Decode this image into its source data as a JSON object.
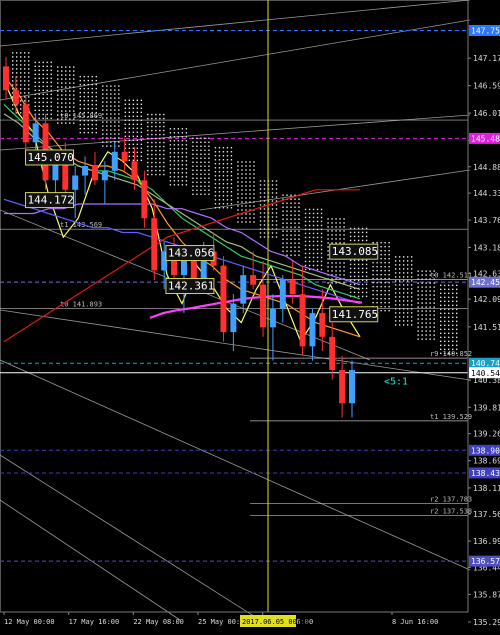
{
  "chart_data": {
    "type": "line",
    "background": "#000000",
    "ylim": [
      135.5,
      148.4
    ],
    "y_ticks": [
      "147.175",
      "146.595",
      "146.015",
      "145.440",
      "144.885",
      "144.330",
      "143.760",
      "143.185",
      "142.635",
      "142.095",
      "141.510",
      "140.385",
      "139.815",
      "139.260",
      "138.690",
      "138.115",
      "137.565",
      "136.995",
      "136.440",
      "135.870",
      "135.290"
    ],
    "x_ticks": [
      "12 May 00:00",
      "17 May 16:00",
      "22 May 08:00",
      "25 May 00:00",
      "29 May 16:00",
      "2017.06.05 00:00",
      "8 Jun 16:00"
    ],
    "highlighted_x_label": "2017.06.05 00:00",
    "price_badges": [
      {
        "text": "147.757",
        "value": 147.757,
        "color": "#2a78ff"
      },
      {
        "text": "145.483",
        "value": 145.483,
        "color": "#e020e0"
      },
      {
        "text": "142.452",
        "value": 142.452,
        "color": "#7070d0"
      },
      {
        "text": "140.744",
        "value": 140.744,
        "color": "#18a0c8"
      },
      {
        "text": "140.543",
        "value": 140.543,
        "color": "#ffffff"
      },
      {
        "text": "138.909",
        "value": 138.909,
        "color": "#4040c0"
      },
      {
        "text": "138.431",
        "value": 138.431,
        "color": "#4040c0"
      },
      {
        "text": "136.572",
        "value": 136.572,
        "color": "#5050c0"
      }
    ],
    "line_labels": [
      {
        "text": "t0 142.511",
        "value": 142.511,
        "anchor": "right"
      },
      {
        "text": "t0 141.893",
        "value": 141.893,
        "anchor": "left"
      },
      {
        "text": "t1 143.569",
        "value": 143.569,
        "anchor": "left"
      },
      {
        "text": "t0 145.869",
        "value": 145.869,
        "anchor": "left"
      },
      {
        "text": "r9 140.852",
        "value": 140.852,
        "anchor": "right"
      },
      {
        "text": "t1 139.529",
        "value": 139.529,
        "anchor": "right"
      },
      {
        "text": "r2 137.783",
        "value": 137.783,
        "anchor": "right"
      },
      {
        "text": "r2 137.538",
        "value": 137.538,
        "anchor": "right"
      }
    ],
    "box_labels": [
      {
        "text": "145.070",
        "value": 145.07,
        "x": 0.14
      },
      {
        "text": "144.172",
        "value": 144.172,
        "x": 0.14
      },
      {
        "text": "143.056",
        "value": 143.056,
        "x": 0.44
      },
      {
        "text": "142.361",
        "value": 142.361,
        "x": 0.44
      },
      {
        "text": "143.085",
        "value": 143.085,
        "x": 0.79
      },
      {
        "text": "141.765",
        "value": 141.765,
        "x": 0.79
      }
    ],
    "ratio_label": {
      "text": "<5:1",
      "color": "#20e0e0"
    },
    "candles": [
      [
        147.0,
        147.2,
        146.3,
        146.5
      ],
      [
        146.5,
        146.8,
        146.0,
        146.2
      ],
      [
        146.2,
        146.4,
        145.2,
        145.4
      ],
      [
        145.4,
        146.0,
        145.0,
        145.8
      ],
      [
        145.8,
        146.0,
        144.4,
        144.6
      ],
      [
        144.6,
        145.2,
        144.0,
        145.0
      ],
      [
        145.0,
        145.4,
        144.2,
        144.4
      ],
      [
        144.4,
        144.9,
        143.8,
        144.7
      ],
      [
        144.7,
        145.1,
        144.3,
        144.9
      ],
      [
        144.9,
        145.2,
        144.5,
        144.6
      ],
      [
        144.6,
        145.0,
        144.1,
        144.8
      ],
      [
        144.8,
        145.4,
        144.6,
        145.2
      ],
      [
        145.2,
        145.5,
        144.8,
        145.0
      ],
      [
        145.0,
        145.3,
        144.4,
        144.6
      ],
      [
        144.6,
        144.8,
        143.6,
        143.8
      ],
      [
        143.8,
        144.2,
        142.5,
        142.7
      ],
      [
        142.7,
        143.3,
        142.3,
        143.1
      ],
      [
        143.1,
        143.4,
        142.4,
        142.6
      ],
      [
        142.6,
        143.0,
        141.8,
        142.9
      ],
      [
        142.9,
        143.2,
        142.4,
        142.5
      ],
      [
        142.5,
        143.3,
        142.3,
        143.1
      ],
      [
        143.1,
        143.5,
        142.7,
        142.8
      ],
      [
        142.8,
        143.0,
        141.2,
        141.4
      ],
      [
        141.4,
        142.2,
        141.0,
        142.0
      ],
      [
        142.0,
        142.8,
        141.8,
        142.6
      ],
      [
        142.6,
        143.1,
        142.3,
        142.4
      ],
      [
        142.4,
        142.9,
        141.3,
        141.5
      ],
      [
        141.5,
        142.2,
        140.8,
        141.9
      ],
      [
        141.9,
        142.6,
        141.6,
        142.5
      ],
      [
        142.5,
        142.9,
        142.0,
        142.2
      ],
      [
        142.2,
        142.8,
        140.9,
        141.1
      ],
      [
        141.1,
        141.9,
        140.8,
        141.8
      ],
      [
        141.8,
        142.3,
        141.0,
        141.3
      ],
      [
        141.3,
        141.6,
        140.4,
        140.6
      ],
      [
        140.6,
        140.9,
        139.6,
        139.9
      ],
      [
        139.9,
        140.8,
        139.6,
        140.6
      ]
    ],
    "series": [
      {
        "color": "#ffff60",
        "values": [
          146.7,
          146.0,
          145.6,
          144.3,
          143.4,
          143.8,
          144.7,
          145.2,
          145.0,
          144.7,
          144.0,
          142.6,
          142.0,
          142.8,
          142.4,
          141.9,
          141.6,
          142.3,
          142.8,
          142.0,
          141.2,
          141.7,
          142.4,
          141.8,
          141.3
        ]
      },
      {
        "color": "#ff9a30",
        "values": [
          146.8,
          146.4,
          145.9,
          145.6,
          145.2,
          145.0,
          144.9,
          144.9,
          144.8,
          144.6,
          144.2,
          143.7,
          143.3,
          143.0,
          142.8,
          142.5,
          142.3,
          142.2,
          142.1,
          142.0,
          141.8,
          141.6,
          141.5,
          141.4,
          141.3
        ]
      },
      {
        "color": "#30d060",
        "values": [
          146.2,
          145.9,
          145.6,
          145.3,
          145.1,
          144.9,
          144.8,
          144.8,
          144.7,
          144.6,
          144.4,
          144.1,
          143.8,
          143.6,
          143.4,
          143.2,
          143.0,
          142.9,
          142.8,
          142.7,
          142.6,
          142.4,
          142.3,
          142.2,
          142.1
        ]
      },
      {
        "color": "#a0c080",
        "values": [
          146.0,
          145.8,
          145.5,
          145.3,
          145.1,
          144.9,
          144.8,
          144.7,
          144.6,
          144.5,
          144.3,
          144.1,
          143.9,
          143.7,
          143.5,
          143.3,
          143.2,
          143.0,
          142.9,
          142.8,
          142.7,
          142.6,
          142.5,
          142.4,
          142.3
        ]
      },
      {
        "color": "#b070ff",
        "values": [
          143.9,
          143.9,
          143.9,
          144.0,
          144.0,
          144.1,
          144.1,
          144.1,
          144.1,
          144.1,
          144.1,
          144.0,
          144.0,
          143.9,
          143.8,
          143.6,
          143.5,
          143.3,
          143.1,
          143.0,
          142.8,
          142.7,
          142.6,
          142.5,
          142.4
        ]
      },
      {
        "color": "#6060ff",
        "values": [
          144.2,
          144.1,
          144.0,
          143.9,
          143.8,
          143.7,
          143.6,
          143.6,
          143.5,
          143.5,
          143.4,
          143.3,
          143.2,
          143.1,
          143.0,
          142.9,
          142.8,
          142.7,
          142.6,
          142.5,
          142.4,
          142.3,
          142.2,
          142.1,
          142.0
        ]
      },
      {
        "color": "#e01818",
        "values": [
          141.2,
          141.4,
          141.6,
          141.8,
          142.0,
          142.2,
          142.4,
          142.6,
          142.8,
          143.0,
          143.2,
          143.4,
          143.5,
          143.6,
          143.7,
          143.8,
          143.9,
          144.0,
          144.1,
          144.2,
          144.3,
          144.4,
          144.4,
          144.4,
          144.4
        ]
      },
      {
        "color": "#ff40ff",
        "values": [
          141.7,
          141.8,
          141.86,
          141.9,
          141.95,
          142.0,
          142.05,
          142.1,
          142.13,
          142.15,
          142.16,
          142.16,
          142.15,
          142.13,
          142.1,
          142.06,
          142.02
        ]
      }
    ],
    "cloud_top": [
      147.3,
      147.1,
      147.0,
      146.8,
      146.6,
      146.3,
      146.0,
      145.7,
      145.5,
      145.3,
      145.0,
      144.6,
      144.3,
      144.0,
      143.8,
      143.6,
      143.3,
      143.0,
      142.7,
      142.4
    ],
    "cloud_bottom": [
      146.0,
      145.9,
      145.8,
      145.6,
      145.3,
      145.0,
      144.7,
      144.5,
      144.3,
      144.0,
      143.7,
      143.4,
      143.0,
      142.7,
      142.4,
      142.1,
      141.8,
      141.5,
      141.2,
      140.9
    ]
  }
}
